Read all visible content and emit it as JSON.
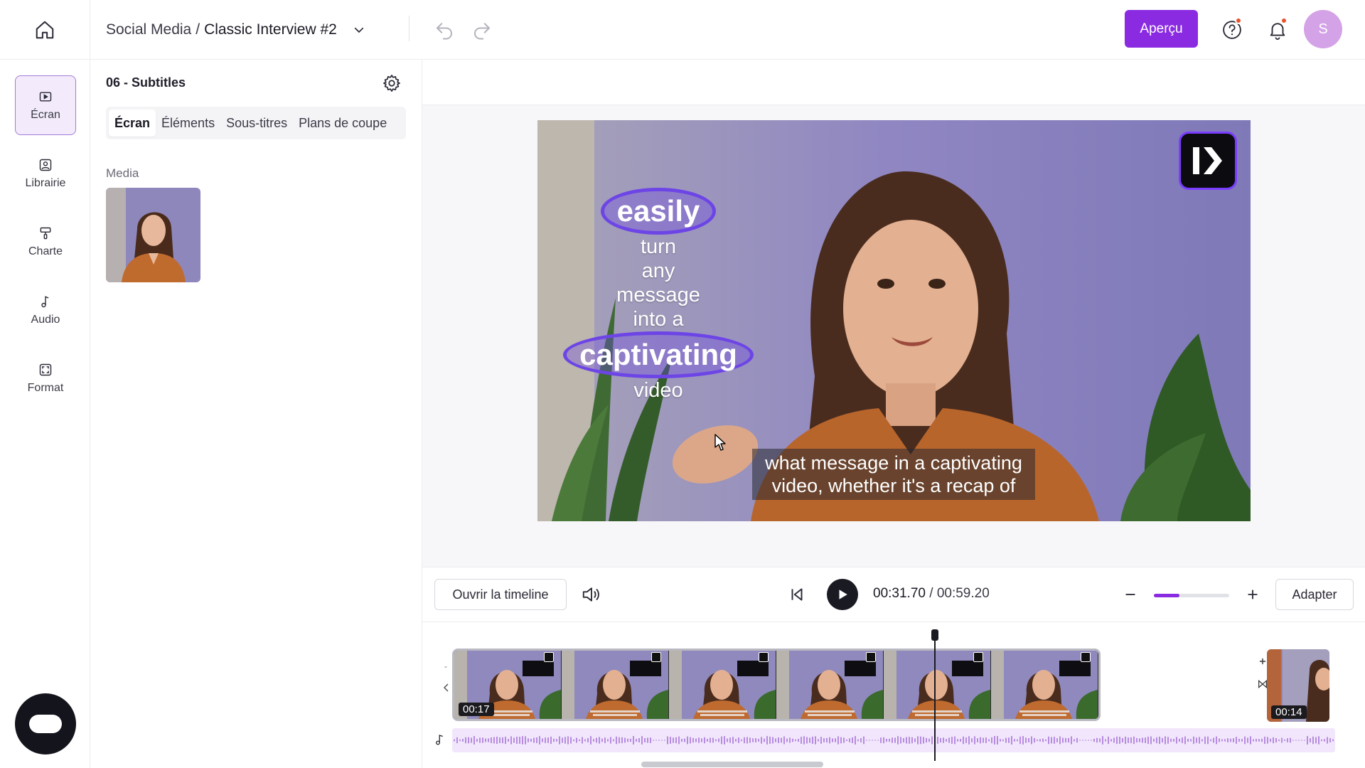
{
  "topbar": {
    "breadcrumb_parent": "Social Media",
    "breadcrumb_separator": "/",
    "breadcrumb_current": "Classic Interview #2",
    "preview_label": "Aperçu",
    "avatar_initial": "S",
    "accent_color": "#8a2be2",
    "notification_dot_color": "#e8532c"
  },
  "leftnav": {
    "items": [
      {
        "label": "Écran",
        "icon": "screen-icon",
        "active": true
      },
      {
        "label": "Librairie",
        "icon": "library-icon",
        "active": false
      },
      {
        "label": "Charte",
        "icon": "paint-roller-icon",
        "active": false
      },
      {
        "label": "Audio",
        "icon": "music-note-icon",
        "active": false
      },
      {
        "label": "Format",
        "icon": "format-icon",
        "active": false
      }
    ]
  },
  "panel": {
    "title": "06 - Subtitles",
    "tabs": [
      {
        "label": "Écran",
        "active": true
      },
      {
        "label": "Éléments",
        "active": false
      },
      {
        "label": "Sous-titres",
        "active": false
      },
      {
        "label": "Plans de coupe",
        "active": false
      }
    ],
    "media_label": "Media"
  },
  "preview": {
    "kinetic_words": [
      "easily",
      "turn",
      "any",
      "message",
      "into a",
      "captivating",
      "video"
    ],
    "subtitle_line1": "what message in a captivating",
    "subtitle_line2": "video, whether it's a recap of"
  },
  "controls": {
    "open_timeline_label": "Ouvrir la timeline",
    "current_time": "00:31.70",
    "time_separator": "/",
    "total_time": "00:59.20",
    "fit_label": "Adapter",
    "zoom_level": 0.34
  },
  "timeline": {
    "clip_start_time": "00:17",
    "next_clip_time": "00:14",
    "playhead_time": "00:31.70"
  }
}
